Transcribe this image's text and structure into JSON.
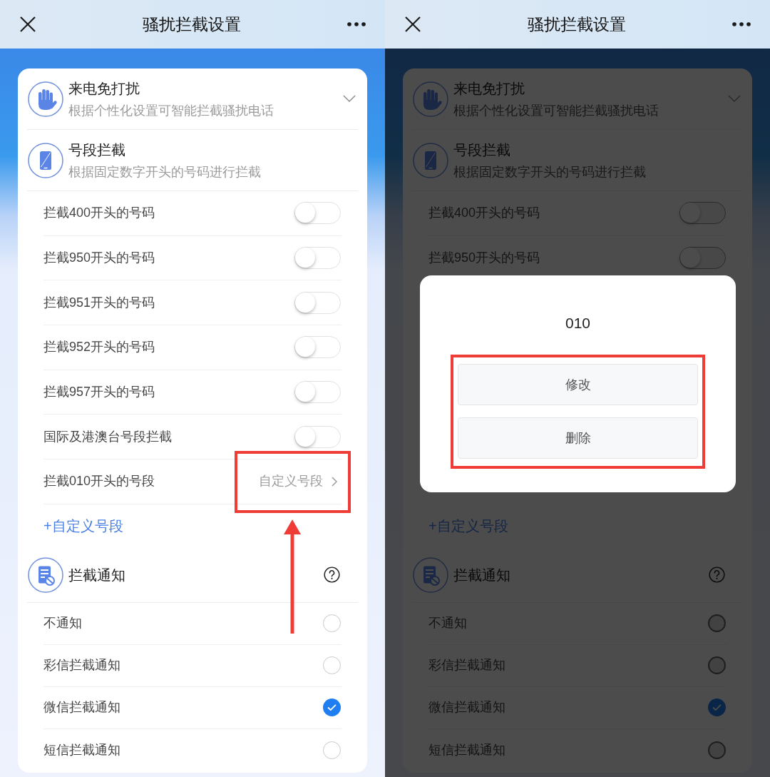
{
  "screens": [
    {
      "title": "骚扰拦截设置",
      "pointer_arrow": true,
      "sections": [
        {
          "kind": "expandable",
          "title": "来电免打扰",
          "subtitle": "根据个性化设置可智能拦截骚扰电话",
          "expanded": false
        },
        {
          "kind": "toggles",
          "title": "号段拦截",
          "subtitle": "根据固定数字开头的号码进行拦截",
          "items": [
            {
              "kind": "switch",
              "label": "拦截400开头的号码",
              "on": false
            },
            {
              "kind": "switch",
              "label": "拦截950开头的号码",
              "on": false
            },
            {
              "kind": "switch",
              "label": "拦截951开头的号码",
              "on": false
            },
            {
              "kind": "switch",
              "label": "拦截952开头的号码",
              "on": false
            },
            {
              "kind": "switch",
              "label": "拦截957开头的号码",
              "on": false
            },
            {
              "kind": "switch",
              "label": "国际及港澳台号段拦截",
              "on": false
            },
            {
              "kind": "link",
              "label": "拦截010开头的号段",
              "value": "自定义号段",
              "highlighted": true
            }
          ],
          "add_link": "+自定义号段"
        },
        {
          "kind": "radio",
          "title": "拦截通知",
          "items": [
            {
              "label": "不通知",
              "selected": false
            },
            {
              "label": "彩信拦截通知",
              "selected": false
            },
            {
              "label": "微信拦截通知",
              "selected": true
            },
            {
              "label": "短信拦截通知",
              "selected": false
            }
          ]
        }
      ]
    },
    {
      "title": "骚扰拦截设置",
      "dimmed": true,
      "sections": [
        {
          "kind": "expandable",
          "title": "来电免打扰",
          "subtitle": "根据个性化设置可智能拦截骚扰电话",
          "expanded": false
        },
        {
          "kind": "toggles",
          "title": "号段拦截",
          "subtitle": "根据固定数字开头的号码进行拦截",
          "items": [
            {
              "kind": "switch",
              "label": "拦截400开头的号码",
              "on": false
            },
            {
              "kind": "switch",
              "label": "拦截950开头的号码",
              "on": false
            }
          ],
          "add_link": "+自定义号段"
        },
        {
          "kind": "radio",
          "title": "拦截通知",
          "items": [
            {
              "label": "不通知",
              "selected": false
            },
            {
              "label": "彩信拦截通知",
              "selected": false
            },
            {
              "label": "微信拦截通知",
              "selected": true
            },
            {
              "label": "短信拦截通知",
              "selected": false
            }
          ]
        }
      ],
      "dialog": {
        "title": "010",
        "buttons": [
          "修改",
          "删除"
        ],
        "highlighted": true
      }
    }
  ]
}
